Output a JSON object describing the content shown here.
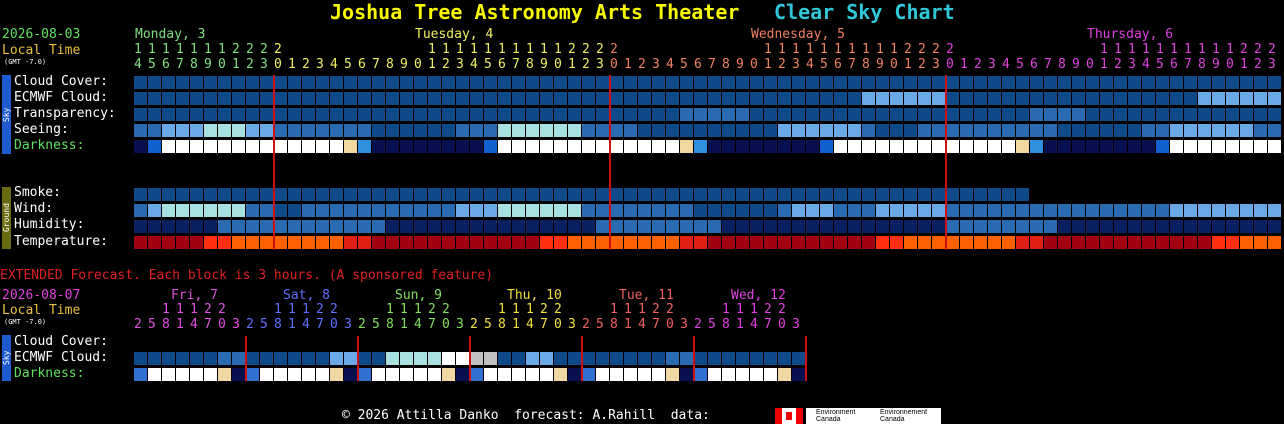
{
  "header": {
    "title": "Joshua Tree Astronomy Arts Theater",
    "subtitle": "Clear Sky Chart"
  },
  "main": {
    "date": "2026-08-03",
    "local_time": "Local Time",
    "gmt": "(GMT -7.0)",
    "days": [
      "Monday, 3",
      "Tuesday, 4",
      "Wednesday, 5",
      "Thursday, 6"
    ],
    "hour_tens": "1111111222200000000001111111111222200000000001111111111222200000000001111111111222",
    "hour_ones": "4567890123012345678901234567890123012345678901234567890123012345678901234567890123",
    "rows": [
      "Cloud Cover:",
      "ECMWF Cloud:",
      "Transparency:",
      "Seeing:",
      "Darkness:",
      "Smoke:",
      "Wind:",
      "Humidity:",
      "Temperature:"
    ],
    "sky_label": "Sky",
    "ground_label": "Ground"
  },
  "extended": {
    "notice": "EXTENDED Forecast. Each block is 3 hours. (A sponsored feature)",
    "date": "2026-08-07",
    "local_time": "Local Time",
    "gmt": "(GMT -7.0)",
    "days": [
      "Fri, 7",
      "Sat, 8",
      "Sun, 9",
      "Thu, 10",
      "Tue, 11",
      "Wed, 12"
    ],
    "hour_tens": "  11122",
    "hour_ones": "25814703",
    "rows": [
      "Cloud Cover:",
      "ECMWF Cloud:",
      "Darkness:"
    ],
    "sky_label": "Sky"
  },
  "footer": {
    "copyright": "© 2026 Attilla Danko  forecast: A.Rahill  data:",
    "env1": "Environment Canada",
    "env2": "Environnement Canada"
  },
  "colors": {
    "title": "#f8f800",
    "subtitle": "#30c8d8",
    "date": "#60e060",
    "local": "#e8c040",
    "mon": "#80e080",
    "tue": "#f0f060",
    "wed": "#f08060",
    "thu": "#e040e0",
    "fri": "#e050e0",
    "sat": "#6070ff",
    "sun": "#80e060",
    "d10": "#f0e040",
    "d11": "#f06060",
    "d12": "#e040e0",
    "notice": "#e02020",
    "darkness_label": "#60e060",
    "sky_bar": "#1e5ad0",
    "ground_bar": "#6a6a10",
    "cloud_dark": "#0e4a8a",
    "cloud_mid": "#2a6ab0",
    "cloud_light": "#6aa8e8",
    "seeing_light": "#a8e0e0",
    "white": "#ffffff",
    "gray": "#c0c0c0",
    "red_line": "#d01010"
  }
}
